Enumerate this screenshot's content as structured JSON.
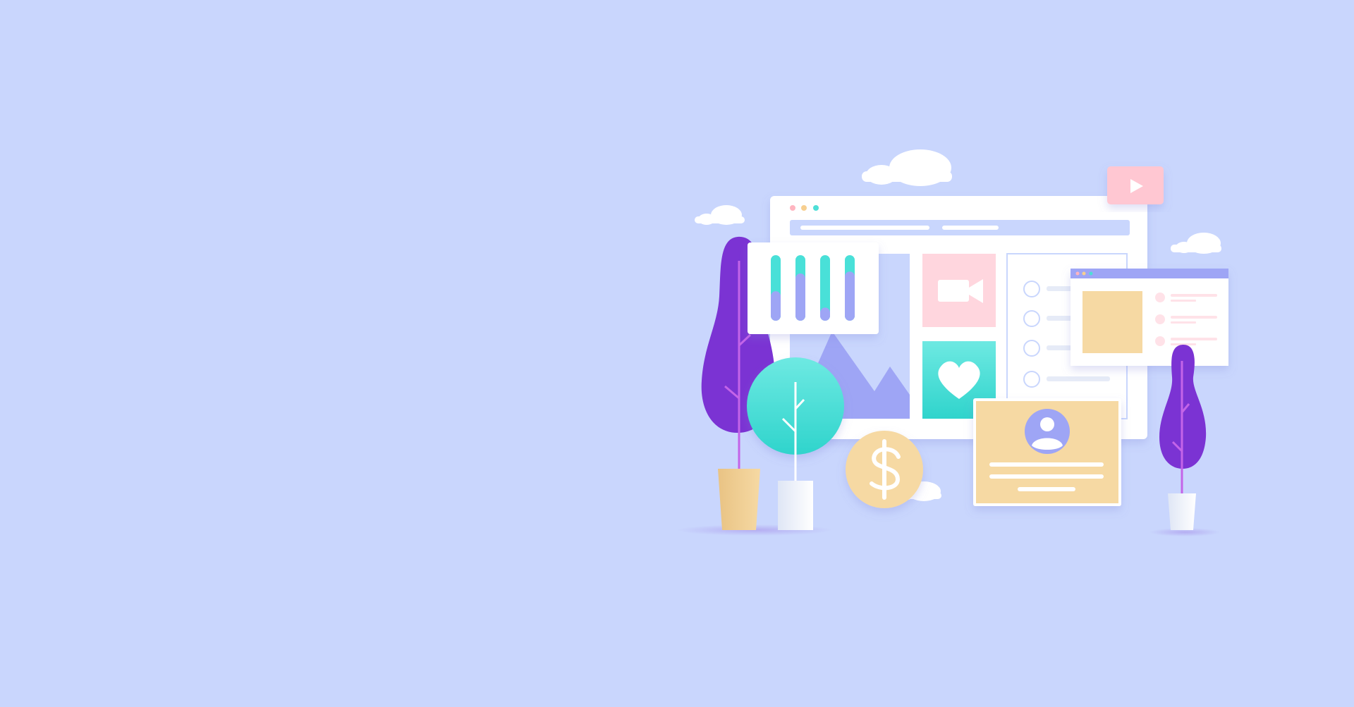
{
  "page": {
    "background_color": "#c9d6fd"
  },
  "illustration": {
    "subject": "web-content-dashboard",
    "icons": [
      "cloud-icon",
      "play-icon",
      "video-camera-icon",
      "heart-icon",
      "image-icon",
      "bar-chart-icon",
      "dollar-icon",
      "user-avatar-icon",
      "plant-icon"
    ],
    "colors": {
      "window": "#ffffff",
      "lavender": "#9ea5f5",
      "pink": "#ffd6de",
      "teal": "#49e0d8",
      "sand": "#f6d9a3",
      "purple": "#7b33d3",
      "address_bar": "#c9d6fd",
      "dot_red": "#ffb5c0",
      "dot_yellow": "#f7cf8f",
      "dot_teal": "#4ddfd7"
    },
    "bar_chart_fills": [
      0.45,
      0.72,
      0.2,
      0.75
    ]
  }
}
